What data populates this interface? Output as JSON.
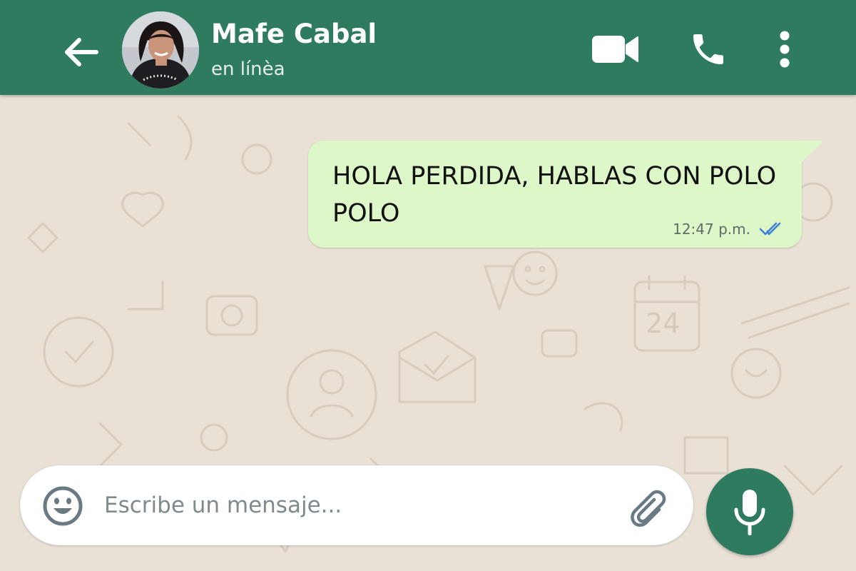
{
  "header": {
    "contact_name": "Mafe Cabal",
    "status": "en línèa",
    "back_icon": "arrow-left-icon",
    "video_icon": "video-camera-icon",
    "call_icon": "phone-icon",
    "menu_icon": "more-vertical-icon"
  },
  "messages": [
    {
      "direction": "outgoing",
      "text": "HOLA PERDIDA, HABLAS CON POLO POLO",
      "time": "12:47 p.m.",
      "status_icon": "double-check-read-icon"
    }
  ],
  "composer": {
    "placeholder": "Escribe un mensaje...",
    "emoji_icon": "emoji-icon",
    "attach_icon": "paperclip-icon",
    "mic_icon": "microphone-icon"
  },
  "colors": {
    "header": "#2e7b5f",
    "wallpaper": "#e9e1d6",
    "outgoing_bubble": "#ddf7c8",
    "read_ticks": "#3b82d6",
    "mic_button": "#2e7b5f"
  }
}
